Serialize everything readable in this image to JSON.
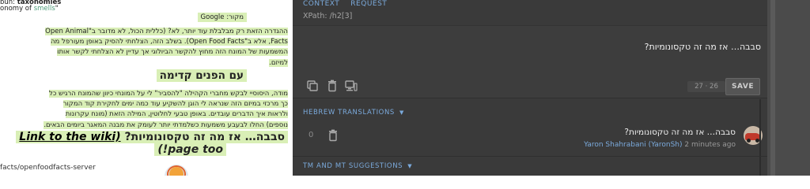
{
  "preview": {
    "line_top_prefix": "bun: ",
    "line_top_bold": "taxonomies",
    "line_top2_prefix": "onomy of ",
    "line_top2_link": "smells",
    "line_top2_suffix": "\"",
    "source_line": "מקור: Google",
    "para1_lines": [
      "ההגדרה הזאת רק מבלבלת עוד יותר, לא? (כללית הכול, לא מדובר ב\"Open Animal",
      "Facts, אלא ב\"Open Food Facts). בשלב הזה, הצלחתי להסיק באופן מעורפל מה",
      "המשמעות של המונח הזה מחוץ להקשר הביולוגי אך עדיין לא הצלחתי לקשר אותו",
      "למיזם."
    ],
    "heading1": "עם הפנים קדימה",
    "para2_lines": [
      "מודה, היסוסיי לבקש מחברי הקהילה \"להסביר\" לי על המונחי כיוון שהמונח הרגיש כל",
      "כך מרכזי במיזם הזה שנראה לי הוגן להשקיע עוד כמה ימים לחקירת קוד המקור",
      "ולראות איך הדברים עובדים. באופן טבעי לחלוטין, המילה הזאת (מונח עקרונות",
      "נוספים) החלו לבעבע משמעות כשלמדתי יותר לעומק את מבנה המאגר ביומים הבאים."
    ],
    "heading2_text": "סבבה… אז מה זה טקסונומיות?",
    "heading2_link": "Link to the wiki)",
    "heading3": "(!page too",
    "footer_url": "facts/openfoodfacts-server"
  },
  "panel": {
    "tabs": [
      "CONTEXT",
      "REQUEST"
    ],
    "xpath": "XPath: /h2[3]",
    "editor_text": "סבבה… אז מה זה טקסונומיות?",
    "counter": "27 · 26",
    "save_label": "SAVE",
    "section_translations": "HEBREW TRANSLATIONS",
    "translation_count": "0",
    "translation_text": "סבבה… אז מה זה טקסונומיות?",
    "translation_author": "Yaron Shahrabani (YaronSh)",
    "translation_time": "2 minutes ago",
    "section_suggestions": "TM AND MT SUGGESTIONS",
    "chevron": "▼"
  },
  "icons": [
    "copy-icon",
    "trash-icon",
    "machine-translate-icon",
    "trash-icon",
    "avatar",
    "avatar"
  ],
  "colors": {
    "highlight": "#d9efb6",
    "panel_bg": "#3a3a3a",
    "accent": "#7baadc",
    "link_green": "#4f9c7b"
  }
}
